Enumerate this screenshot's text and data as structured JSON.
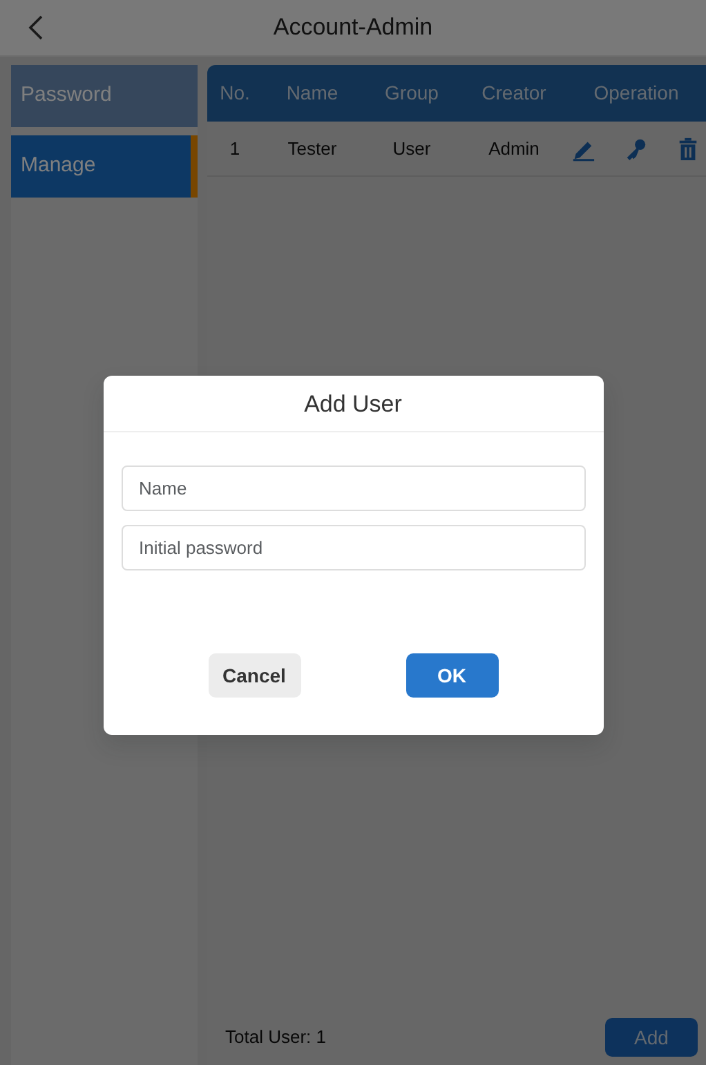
{
  "header": {
    "title": "Account-Admin"
  },
  "sidebar": {
    "items": [
      {
        "label": "Password",
        "selected": false
      },
      {
        "label": "Manage",
        "selected": true
      }
    ]
  },
  "table": {
    "columns": [
      "No.",
      "Name",
      "Group",
      "Creator",
      "Operation"
    ],
    "rows": [
      {
        "cells": [
          "1",
          "Tester",
          "User",
          "Admin"
        ]
      }
    ]
  },
  "footer": {
    "total": "Total User:  1",
    "add_button": "Add"
  },
  "dialog": {
    "title": "Add User",
    "fields": [
      {
        "placeholder": "Name"
      },
      {
        "placeholder": "Initial password"
      }
    ],
    "buttons": [
      {
        "label": "Cancel",
        "kind": "secondary"
      },
      {
        "label": "OK",
        "kind": "primary"
      }
    ]
  }
}
